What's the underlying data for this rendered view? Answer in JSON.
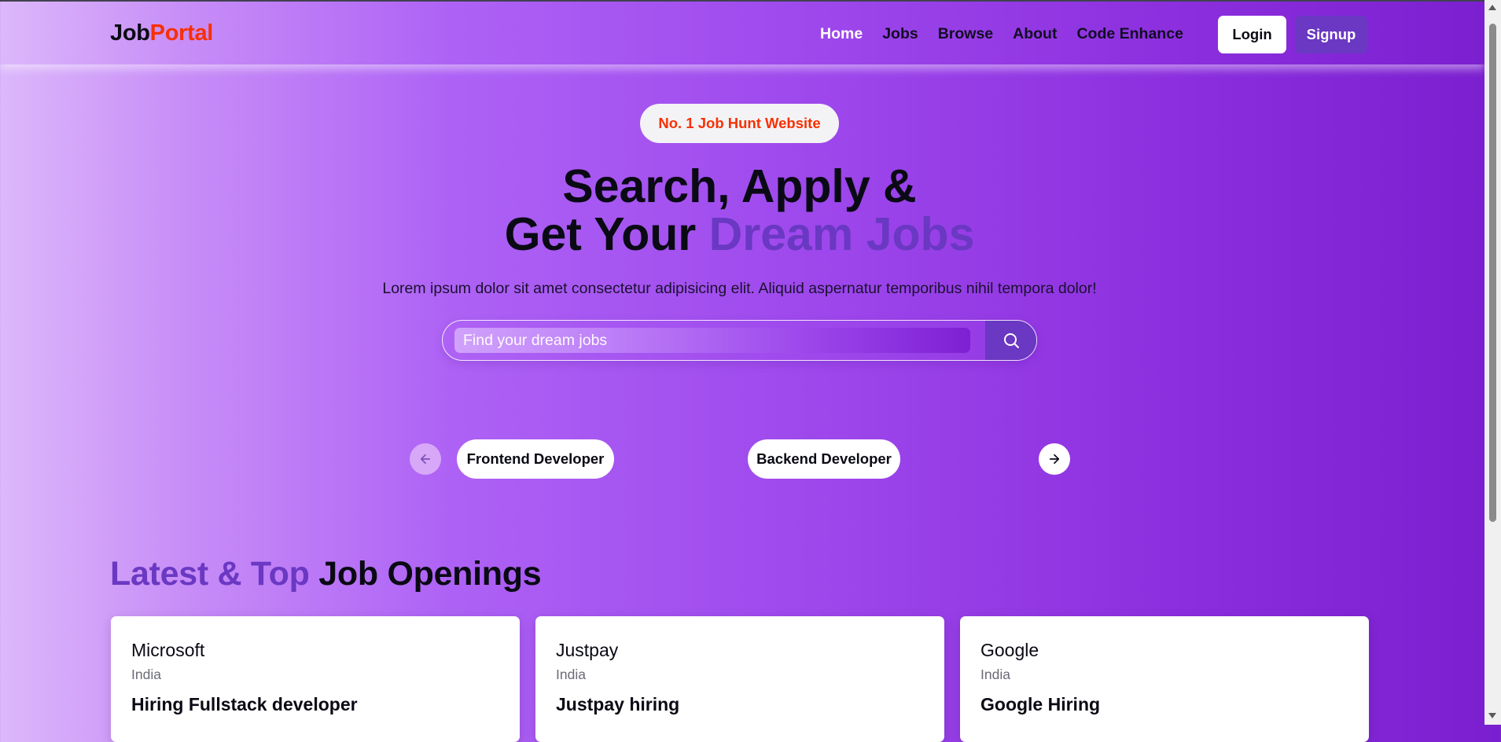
{
  "brand": {
    "part1": "Job",
    "part2": "Portal",
    "accent_color": "#f83002"
  },
  "nav": {
    "links": [
      "Home",
      "Jobs",
      "Browse",
      "About",
      "Code Enhance"
    ],
    "active": "Home"
  },
  "auth": {
    "login_label": "Login",
    "signup_label": "Signup"
  },
  "hero": {
    "badge": "No. 1 Job Hunt Website",
    "title_line1": "Search, Apply &",
    "title_line2_plain": "Get Your ",
    "title_line2_accent": "Dream Jobs",
    "subtitle": "Lorem ipsum dolor sit amet consectetur adipisicing elit. Aliquid aspernatur temporibus nihil tempora dolor!",
    "search_placeholder": "Find your dream jobs",
    "search_icon": "search-icon"
  },
  "categories": {
    "items": [
      "Frontend Developer",
      "Backend Developer"
    ],
    "prev_icon": "arrow-left-icon",
    "next_icon": "arrow-right-icon"
  },
  "latest": {
    "title_accent": "Latest & Top",
    "title_plain": " Job Openings",
    "jobs": [
      {
        "company": "Microsoft",
        "location": "India",
        "title": "Hiring Fullstack developer"
      },
      {
        "company": "Justpay",
        "location": "India",
        "title": "Justpay hiring"
      },
      {
        "company": "Google",
        "location": "India",
        "title": "Google Hiring"
      }
    ]
  },
  "colors": {
    "primary": "#6a38c2",
    "highlight": "#f83002"
  }
}
